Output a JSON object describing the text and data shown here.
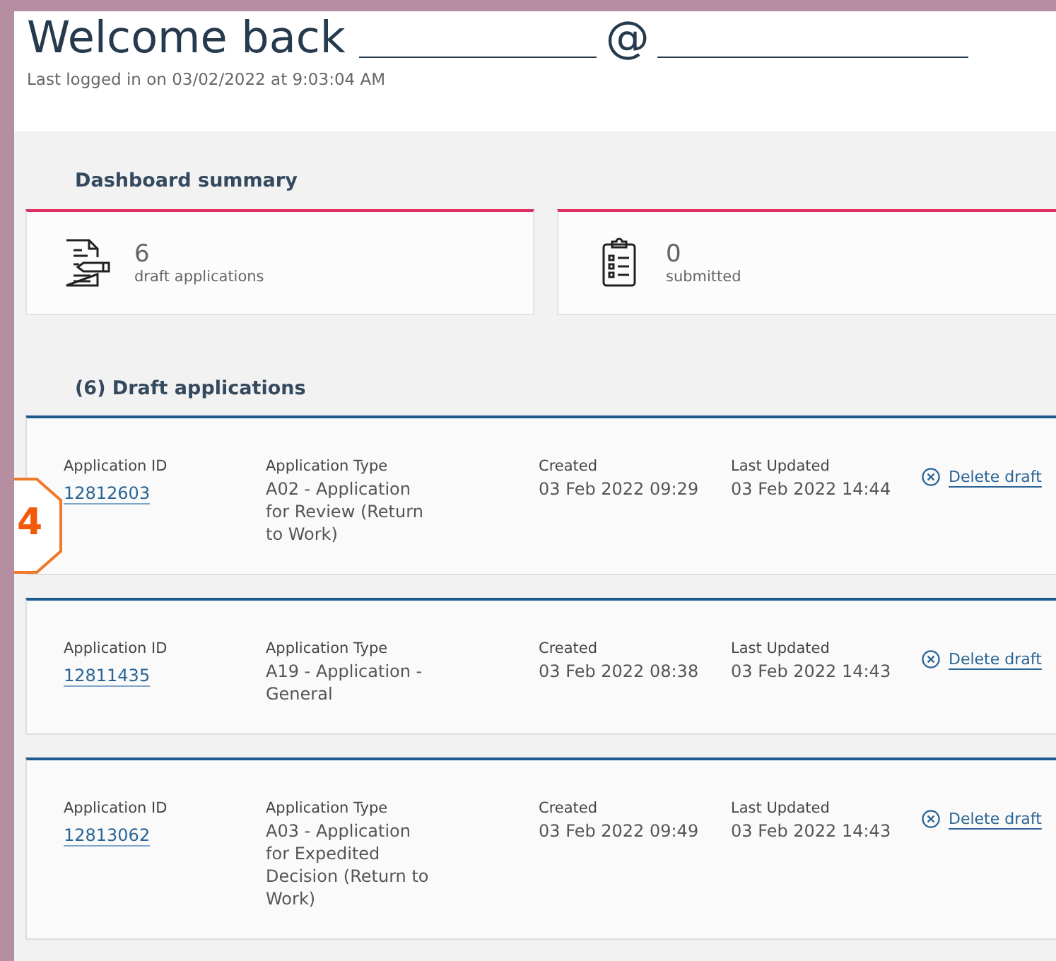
{
  "header": {
    "greeting": "Welcome back",
    "separator": "@",
    "last_login": "Last logged in on 03/02/2022 at 9:03:04 AM"
  },
  "summary": {
    "title": "Dashboard summary",
    "cards": [
      {
        "kind": "draft",
        "count": "6",
        "label": "draft applications"
      },
      {
        "kind": "submitted",
        "count": "0",
        "label": "submitted"
      }
    ]
  },
  "drafts": {
    "title": "(6) Draft applications",
    "rows": [
      {
        "id_label": "Application ID",
        "id": "12812603",
        "type_label": "Application Type",
        "type": "A02 - Application for Review (Return to Work)",
        "created_label": "Created",
        "created": "03 Feb 2022 09:29",
        "updated_label": "Last Updated",
        "updated": "03 Feb 2022 14:44",
        "action": "Delete draft"
      },
      {
        "id_label": "Application ID",
        "id": "12811435",
        "type_label": "Application Type",
        "type": "A19 - Application - General",
        "created_label": "Created",
        "created": "03 Feb 2022 08:38",
        "updated_label": "Last Updated",
        "updated": "03 Feb 2022 14:43",
        "action": "Delete draft"
      },
      {
        "id_label": "Application ID",
        "id": "12813062",
        "type_label": "Application Type",
        "type": "A03 - Application for Expedited Decision (Return to Work)",
        "created_label": "Created",
        "created": "03 Feb 2022 09:49",
        "updated_label": "Last Updated",
        "updated": "03 Feb 2022 14:43",
        "action": "Delete draft"
      }
    ]
  },
  "callout": {
    "label": "4"
  }
}
